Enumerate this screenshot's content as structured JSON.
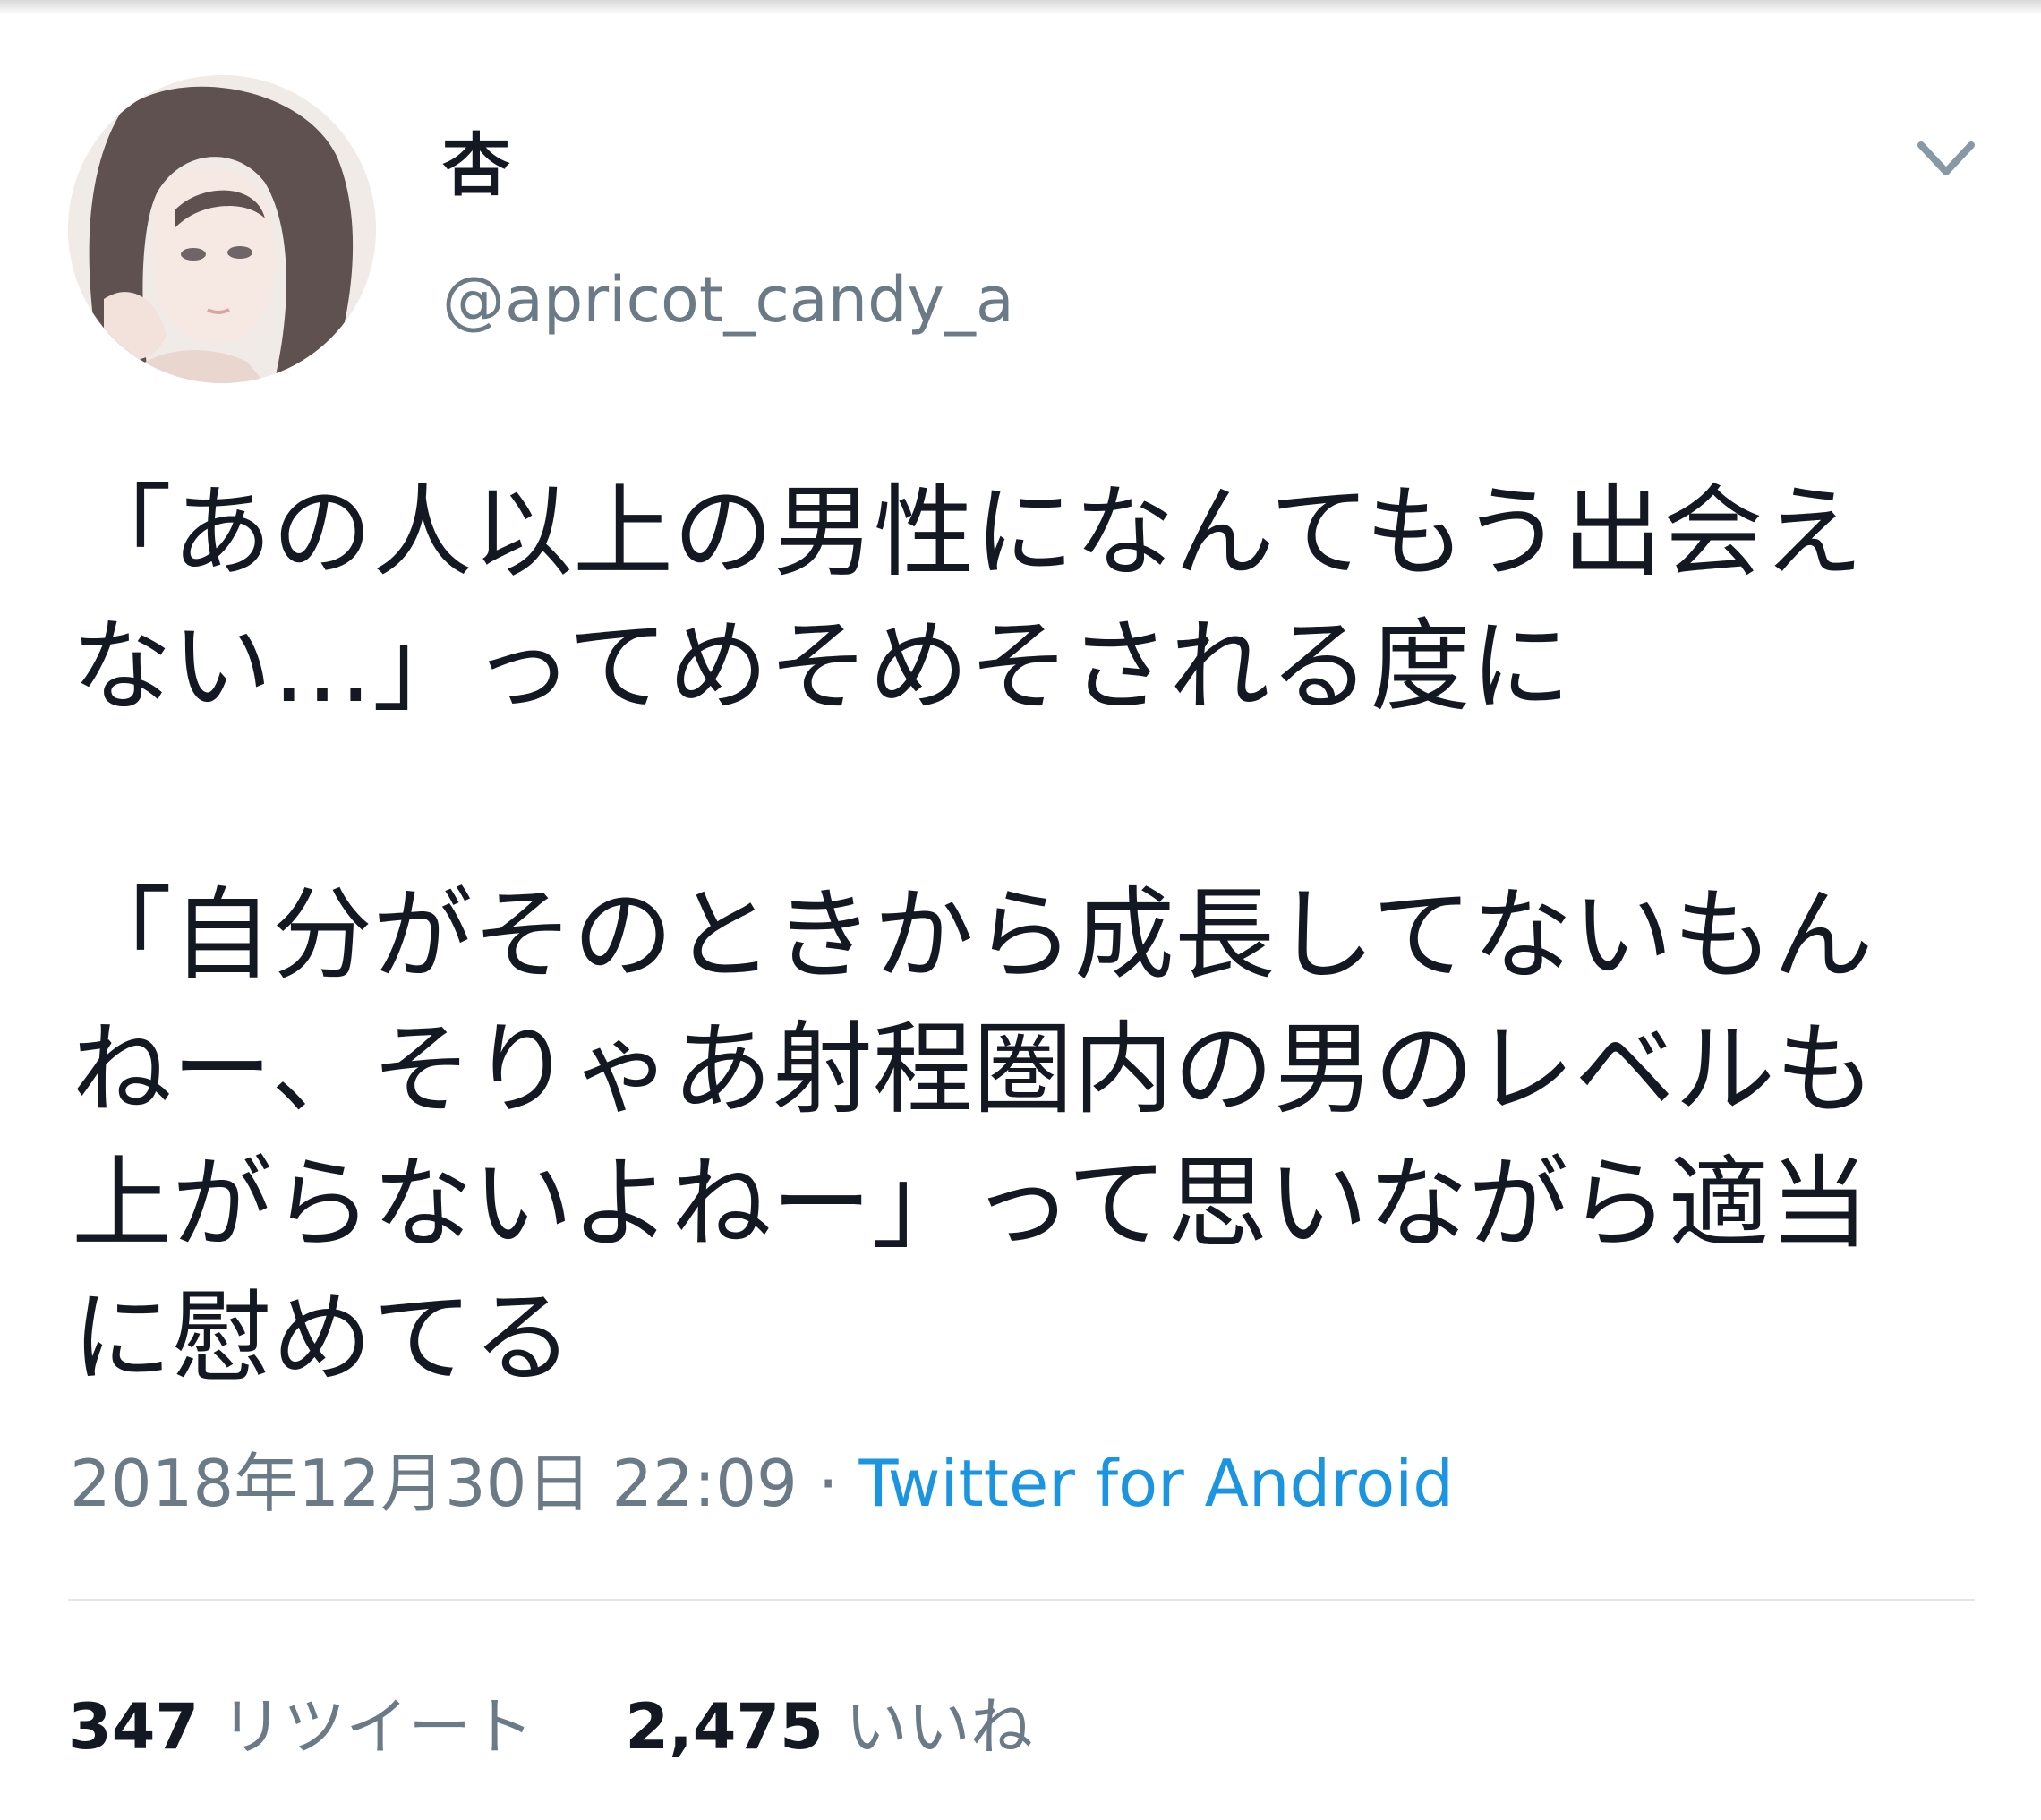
{
  "tweet": {
    "display_name": "杏",
    "handle": "@apricot_candy_a",
    "text_paragraphs": [
      [
        "「あの人以上の男性になんてもう出会え",
        "ない…」ってめそめそされる度に"
      ],
      [
        "「自分がそのときから成長してないもん",
        "ねー、そりゃあ射程圏内の男のレベルも",
        "上がらないよねー」って思いながら適当",
        "に慰めてる"
      ]
    ],
    "timestamp": "2018年12月30日 22:09",
    "separator": " · ",
    "source": "Twitter for Android",
    "retweets": {
      "count": "347",
      "label": "リツイート"
    },
    "likes": {
      "count": "2,475",
      "label": "いいね"
    }
  },
  "colors": {
    "text": "#141823",
    "secondary": "#6b7a87",
    "link": "#1b95e0",
    "divider": "#e1e8ed"
  },
  "icons": {
    "avatar": "avatar-illustration",
    "menu": "chevron-down-icon"
  }
}
